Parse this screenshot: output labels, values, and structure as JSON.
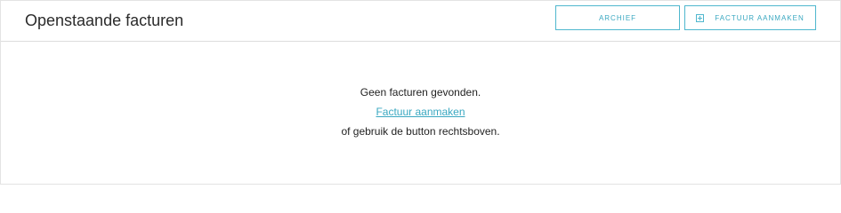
{
  "header": {
    "title": "Openstaande facturen",
    "archive_label": "ARCHIEF",
    "create_label": "FACTUUR AANMAKEN",
    "create_icon": "plus-square-icon"
  },
  "empty_state": {
    "message": "Geen facturen gevonden.",
    "link_label": "Factuur aanmaken",
    "hint": "of gebruik de button rechtsboven."
  },
  "colors": {
    "accent": "#4fb7ce",
    "border": "#dddddd"
  }
}
